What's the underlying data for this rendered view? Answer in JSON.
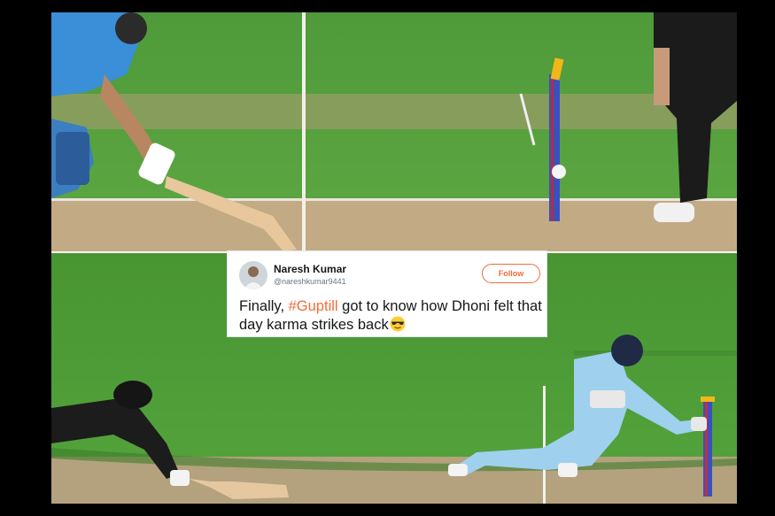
{
  "tweet": {
    "user_name": "Naresh Kumar",
    "user_handle": "@nareshkumar9441",
    "follow_label": "Follow",
    "text_before": "Finally, ",
    "hashtag": "#Guptill",
    "text_after": " got to know how Dhoni felt that day karma strikes back",
    "emoji": "sunglasses-emoji"
  },
  "colors": {
    "accent": "#f26b3a",
    "pitch_green": "#4f9a3a",
    "india_blue": "#3a8fd8",
    "nz_black": "#1c1c1c",
    "england_blue": "#9fd0ee"
  }
}
